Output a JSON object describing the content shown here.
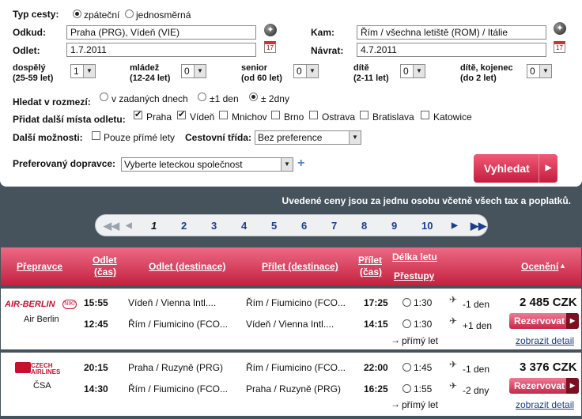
{
  "form": {
    "trip_type_label": "Typ cesty:",
    "trip_return": "zpáteční",
    "trip_oneway": "jednosměrná",
    "from_label": "Odkud:",
    "from_value": "Praha (PRG), Vídeň (VIE)",
    "to_label": "Kam:",
    "to_value": "Řím / všechna letiště (ROM) / Itálie",
    "depart_label": "Odlet:",
    "depart_value": "1.7.2011",
    "return_label": "Návrat:",
    "return_value": "4.7.2011",
    "calendar_text": "17",
    "passengers": [
      {
        "label": "dospělý",
        "sub": "(25-59 let)",
        "value": "1"
      },
      {
        "label": "mládež",
        "sub": "(12-24 let)",
        "value": "0"
      },
      {
        "label": "senior",
        "sub": "(od 60 let)",
        "value": "0"
      },
      {
        "label": "dítě",
        "sub": "(2-11 let)",
        "value": "0"
      },
      {
        "label": "dítě, kojenec",
        "sub": "(do 2 let)",
        "value": "0"
      }
    ],
    "range_label": "Hledat v rozmezí:",
    "range_options": [
      "v zadaných dnech",
      "±1 den",
      "± 2dny"
    ],
    "more_dep_label": "Přidat další místa odletu:",
    "more_dep": [
      "Praha",
      "Vídeň",
      "Mnichov",
      "Brno",
      "Ostrava",
      "Bratislava",
      "Katowice"
    ],
    "other_label": "Další možnosti:",
    "direct_only": "Pouze přímé lety",
    "class_label": "Cestovní třída:",
    "class_value": "Bez preference",
    "carrier_label": "Preferovaný dopravce:",
    "carrier_value": "Vyberte leteckou společnost",
    "search_button": "Vyhledat"
  },
  "notice": "Uvedené ceny jsou za jednu osobu včetně všech tax a poplatků.",
  "pager": {
    "pages": [
      "1",
      "2",
      "3",
      "4",
      "5",
      "6",
      "7",
      "8",
      "9",
      "10"
    ],
    "current": "1"
  },
  "table_header": {
    "carrier": "Přepravce",
    "dep_time_1": "Odlet",
    "dep_time_2": "(čas)",
    "dep_dest": "Odlet (destinace)",
    "arr_dest": "Přílet (destinace)",
    "arr_time_1": "Přílet",
    "arr_time_2": "(čas)",
    "duration": "Délka letu",
    "stops": "Přestupy",
    "price": "Ocenění"
  },
  "results": [
    {
      "airline_logo": "AIR-BERLIN",
      "airline_name": "Air Berlin",
      "price": "2 485 CZK",
      "reserve": "Rezervovat",
      "detail": "zobrazit detail",
      "direct": "přímý let",
      "legs": [
        {
          "dep_time": "15:55",
          "dep": "Vídeň / Vienna Intl....",
          "arr": "Řím / Fiumicino (FCO...",
          "arr_time": "17:25",
          "duration": "1:30",
          "day": "-1 den"
        },
        {
          "dep_time": "12:45",
          "dep": "Řím / Fiumicino (FCO...",
          "arr": "Vídeň / Vienna Intl....",
          "arr_time": "14:15",
          "duration": "1:30",
          "day": "+1 den"
        }
      ]
    },
    {
      "airline_logo": "CZECH AIRLINES",
      "airline_name": "ČSA",
      "price": "3 376 CZK",
      "reserve": "Rezervovat",
      "detail": "zobrazit detail",
      "direct": "přímý let",
      "legs": [
        {
          "dep_time": "20:15",
          "dep": "Praha / Ruzyně (PRG)",
          "arr": "Řím / Fiumicino (FCO...",
          "arr_time": "22:00",
          "duration": "1:45",
          "day": "-1 den"
        },
        {
          "dep_time": "14:30",
          "dep": "Řím / Fiumicino (FCO...",
          "arr": "Praha / Ruzyně (PRG)",
          "arr_time": "16:25",
          "duration": "1:55",
          "day": "-2 dny"
        }
      ]
    }
  ],
  "colors": {
    "accent": "#c61c3d",
    "background": "#46535c",
    "link": "#1c3d8c"
  }
}
